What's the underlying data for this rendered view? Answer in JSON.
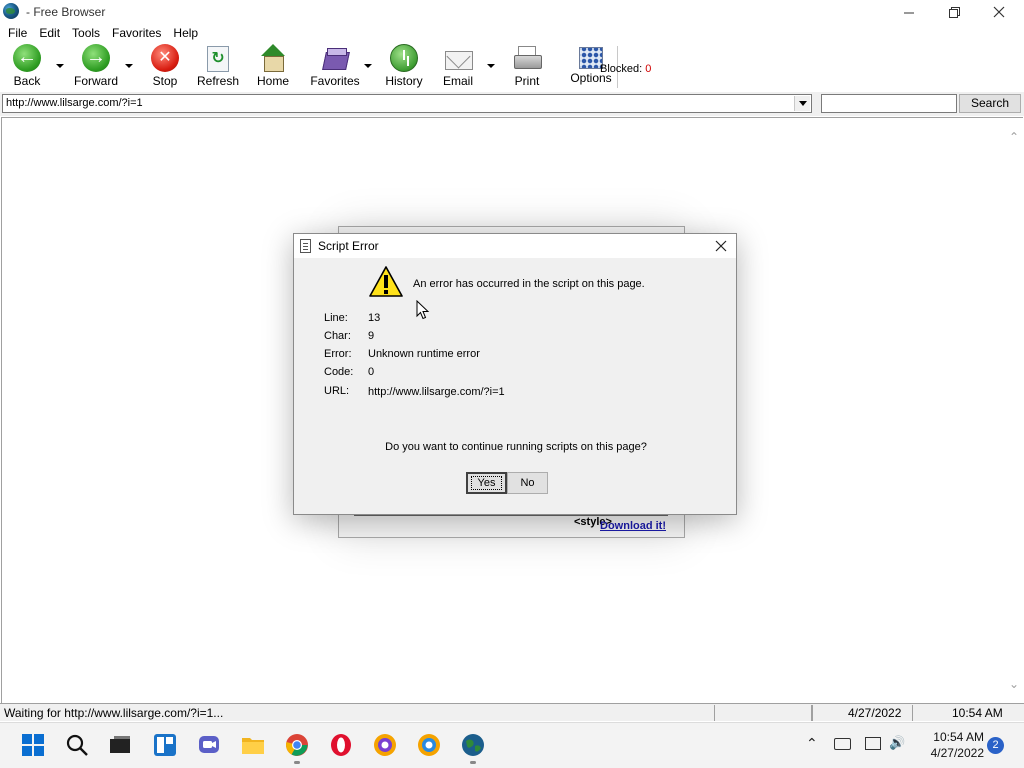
{
  "window": {
    "title": "- Free Browser",
    "minimize_icon": "minimize-icon",
    "maximize_icon": "restore-icon",
    "close_icon": "close-icon"
  },
  "menu": [
    "File",
    "Edit",
    "Tools",
    "Favorites",
    "Help"
  ],
  "toolbar": {
    "back": "Back",
    "forward": "Forward",
    "stop": "Stop",
    "refresh": "Refresh",
    "home": "Home",
    "favorites": "Favorites",
    "history": "History",
    "email": "Email",
    "print": "Print",
    "options": "Options",
    "blocked_label": "Blocked:",
    "blocked_count": "0"
  },
  "address": {
    "url": "http://www.lilsarge.com/?i=1",
    "search_value": "",
    "search_button": "Search"
  },
  "background_page": {
    "style_text": "<style>",
    "download_link": "Download it!"
  },
  "dialog": {
    "title": "Script Error",
    "message": "An error has occurred in the script on this page.",
    "details": [
      {
        "label": "Line:",
        "value": "13"
      },
      {
        "label": "Char:",
        "value": "9"
      },
      {
        "label": "Error:",
        "value": "Unknown runtime error"
      },
      {
        "label": "Code:",
        "value": "0"
      },
      {
        "label": "URL:",
        "value": "http://www.lilsarge.com/?i=1"
      }
    ],
    "question": "Do you want to continue running scripts on this page?",
    "yes_button": "Yes",
    "no_button": "No"
  },
  "status": {
    "text": "Waiting for http://www.lilsarge.com/?i=1...",
    "date": "4/27/2022",
    "time": "10:54 AM"
  },
  "taskbar": {
    "apps": [
      "windows-start-icon",
      "search-icon",
      "task-view-icon",
      "widgets-icon",
      "teams-chat-icon",
      "file-explorer-icon",
      "chrome-icon",
      "opera-icon",
      "browser-icon",
      "browser-icon",
      "free-browser-icon"
    ],
    "time": "10:54 AM",
    "date": "4/27/2022",
    "notification_count": "2"
  },
  "colors": {
    "blocked_count": "#d00000",
    "link": "#1a1aaa",
    "badge": "#2a62c8"
  }
}
